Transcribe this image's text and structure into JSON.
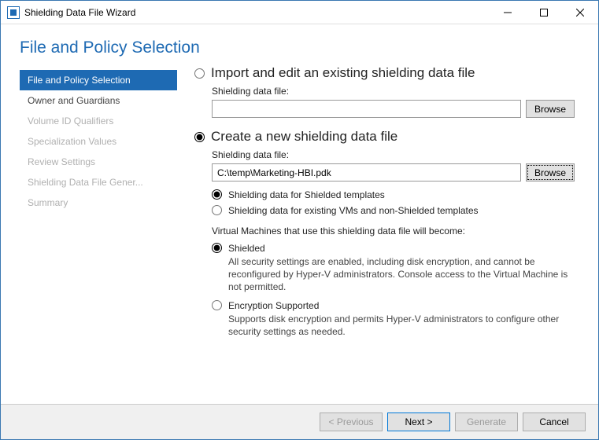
{
  "window": {
    "title": "Shielding Data File Wizard"
  },
  "page": {
    "heading": "File and Policy Selection"
  },
  "sidebar": {
    "items": [
      {
        "label": "File and Policy Selection"
      },
      {
        "label": "Owner and Guardians"
      },
      {
        "label": "Volume ID Qualifiers"
      },
      {
        "label": "Specialization Values"
      },
      {
        "label": "Review Settings"
      },
      {
        "label": "Shielding Data File Gener..."
      },
      {
        "label": "Summary"
      }
    ]
  },
  "content": {
    "import_title": "Import and edit an existing shielding data file",
    "import_field_label": "Shielding data file:",
    "import_value": "",
    "import_browse": "Browse",
    "create_title": "Create a new shielding data file",
    "create_field_label": "Shielding data file:",
    "create_value": "C:\\temp\\Marketing-HBI.pdk",
    "create_browse": "Browse",
    "tmpl_shielded": "Shielding data for Shielded templates",
    "tmpl_existing": "Shielding data for existing VMs and non-Shielded templates",
    "vm_intro": "Virtual Machines that use this shielding data file will become:",
    "shielded_label": "Shielded",
    "shielded_desc": "All security settings are enabled, including disk encryption, and cannot be reconfigured by Hyper-V administrators. Console access to the Virtual Machine is not permitted.",
    "enc_label": "Encryption Supported",
    "enc_desc": "Supports disk encryption and permits Hyper-V administrators to configure other security settings as needed."
  },
  "footer": {
    "previous": "< Previous",
    "next": "Next >",
    "generate": "Generate",
    "cancel": "Cancel"
  }
}
